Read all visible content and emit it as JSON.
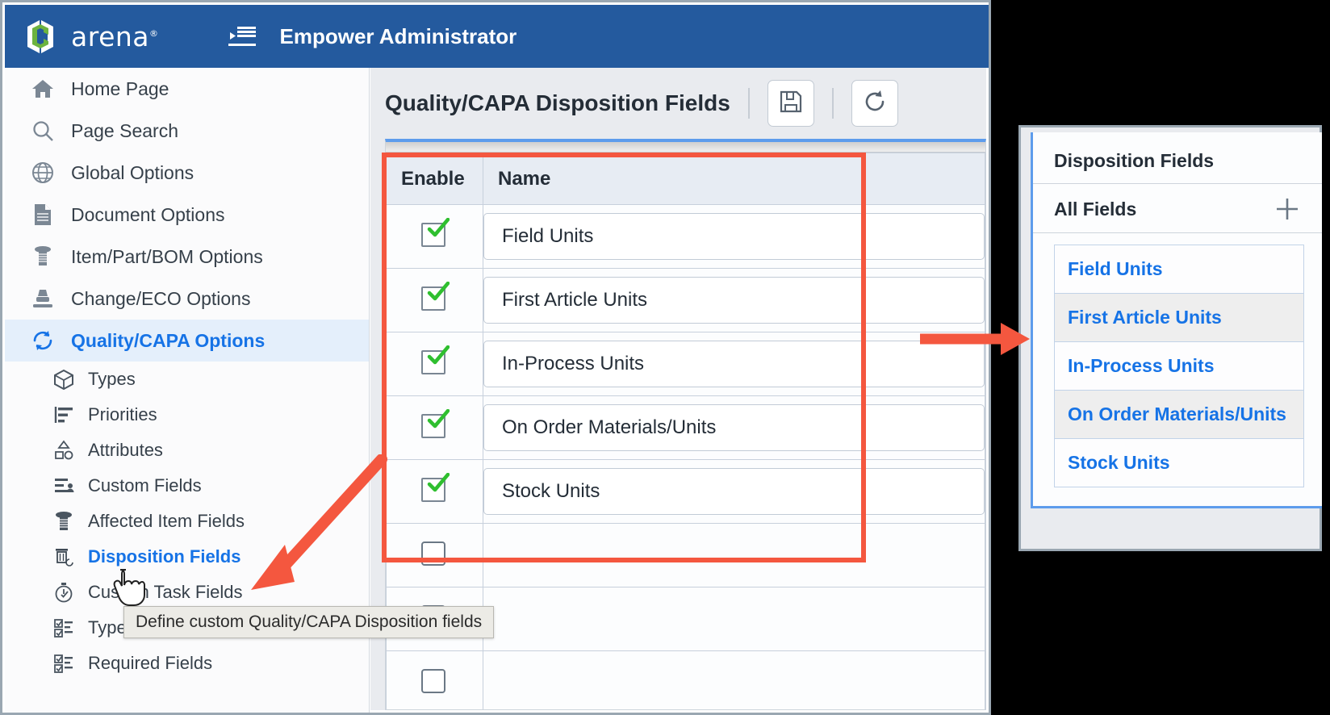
{
  "app": {
    "brand_name": "arena",
    "brand_registered_mark": "®",
    "header_title": "Empower Administrator",
    "collapse_icon": "collapse-menu-icon"
  },
  "sidebar": {
    "items": [
      {
        "label": "Home Page",
        "icon": "home-icon",
        "active": false
      },
      {
        "label": "Page Search",
        "icon": "search-icon",
        "active": false
      },
      {
        "label": "Global Options",
        "icon": "globe-icon",
        "active": false
      },
      {
        "label": "Document Options",
        "icon": "document-icon",
        "active": false
      },
      {
        "label": "Item/Part/BOM Options",
        "icon": "bolt-icon",
        "active": false
      },
      {
        "label": "Change/ECO Options",
        "icon": "stamp-icon",
        "active": false
      },
      {
        "label": "Quality/CAPA Options",
        "icon": "refresh-cycle-icon",
        "active": true
      }
    ],
    "sub_items": [
      {
        "label": "Types",
        "icon": "box-icon",
        "selected": false
      },
      {
        "label": "Priorities",
        "icon": "bar-list-icon",
        "selected": false
      },
      {
        "label": "Attributes",
        "icon": "shapes-icon",
        "selected": false
      },
      {
        "label": "Custom Fields",
        "icon": "person-list-icon",
        "selected": false
      },
      {
        "label": "Affected Item Fields",
        "icon": "bolt-icon",
        "selected": false
      },
      {
        "label": "Disposition Fields",
        "icon": "disposition-icon",
        "selected": true
      },
      {
        "label": "Custom Task Fields",
        "icon": "stopwatch-icon",
        "selected": false
      },
      {
        "label": "Type Fields",
        "icon": "checklist-icon",
        "selected": false
      },
      {
        "label": "Required Fields",
        "icon": "checklist-icon",
        "selected": false
      }
    ]
  },
  "tooltip": {
    "text": "Define custom Quality/CAPA Disposition fields"
  },
  "main": {
    "page_title": "Quality/CAPA Disposition Fields",
    "toolbar": {
      "save_label": "save-icon",
      "refresh_label": "refresh-icon"
    },
    "table": {
      "columns": [
        "Enable",
        "Name"
      ],
      "rows": [
        {
          "enabled": true,
          "name": "Field Units"
        },
        {
          "enabled": true,
          "name": "First Article Units"
        },
        {
          "enabled": true,
          "name": "In-Process Units"
        },
        {
          "enabled": true,
          "name": "On Order Materials/Units"
        },
        {
          "enabled": true,
          "name": "Stock Units"
        },
        {
          "enabled": false,
          "name": ""
        },
        {
          "enabled": false,
          "name": ""
        },
        {
          "enabled": false,
          "name": ""
        }
      ]
    }
  },
  "right_panel": {
    "title": "Disposition Fields",
    "section_label": "All Fields",
    "add_icon": "plus-icon",
    "items": [
      "Field Units",
      "First Article Units",
      "In-Process Units",
      "On Order Materials/Units",
      "Stock Units"
    ]
  },
  "annotations": {
    "highlight_color": "#f4573f",
    "accent_blue": "#1673e6",
    "header_blue": "#245a9e",
    "check_green": "#2fbf2f"
  }
}
